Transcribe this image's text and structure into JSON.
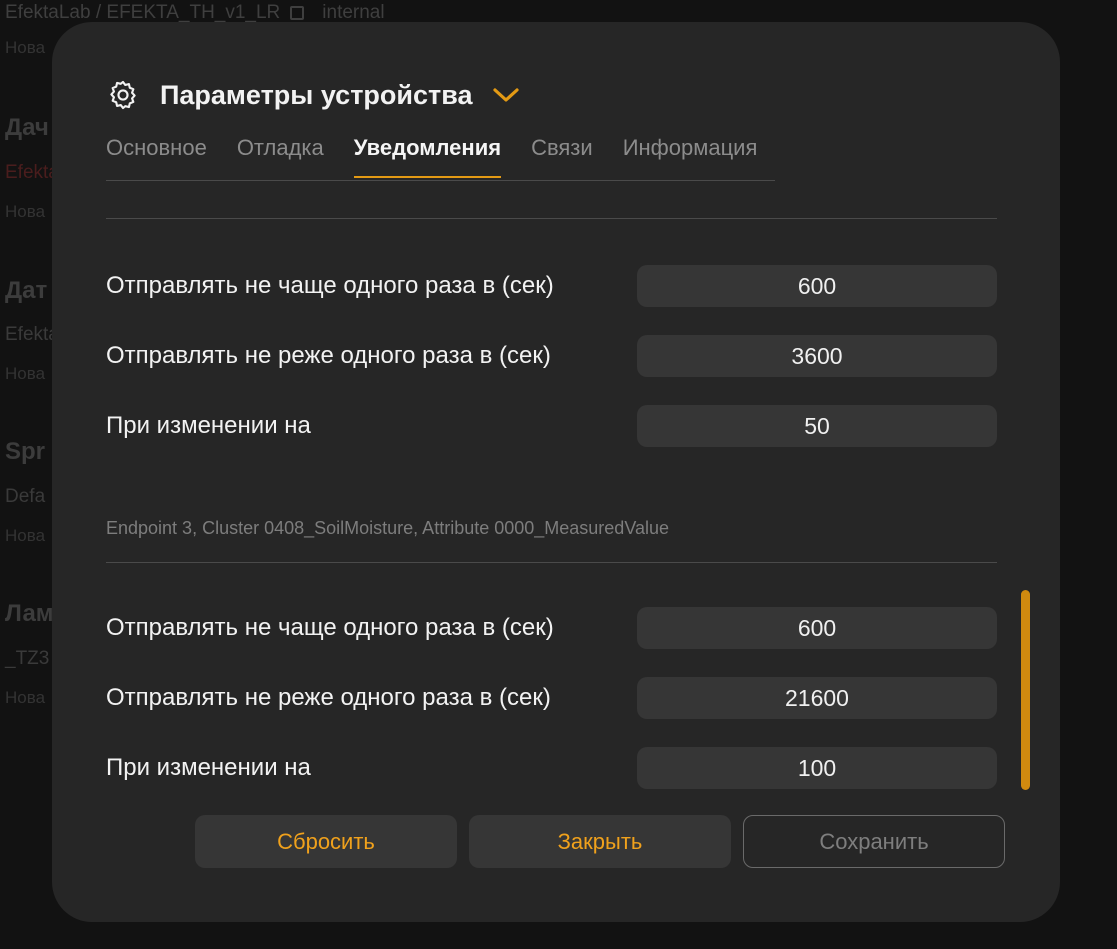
{
  "background": {
    "header_text": "EfektaLab / EFEKTA_TH_v1_LR",
    "header_tag": "internal",
    "items": [
      {
        "title": "Дач",
        "model": "Efekta",
        "sub": "Нова"
      },
      {
        "title": "Дат",
        "model": "Efekta",
        "sub": "Нова"
      },
      {
        "title": "Spr",
        "model": "Defa",
        "sub": "Нова"
      },
      {
        "title": "Лам",
        "model": "_TZ3",
        "sub": "Нова"
      }
    ],
    "first_sub": "Нова"
  },
  "modal": {
    "title": "Параметры устройства",
    "tabs": [
      {
        "label": "Основное",
        "active": false
      },
      {
        "label": "Отладка",
        "active": false
      },
      {
        "label": "Уведомления",
        "active": true
      },
      {
        "label": "Связи",
        "active": false
      },
      {
        "label": "Информация",
        "active": false
      }
    ],
    "section1": {
      "rows": [
        {
          "label": "Отправлять не чаще одного раза в (сек)",
          "value": "600"
        },
        {
          "label": "Отправлять не реже одного раза в (сек)",
          "value": "3600"
        },
        {
          "label": "При изменении на",
          "value": "50"
        }
      ]
    },
    "section2": {
      "caption": "Endpoint 3, Cluster 0408_SoilMoisture, Attribute 0000_MeasuredValue",
      "rows": [
        {
          "label": "Отправлять не чаще одного раза в (сек)",
          "value": "600"
        },
        {
          "label": "Отправлять не реже одного раза в (сек)",
          "value": "21600"
        },
        {
          "label": "При изменении на",
          "value": "100"
        }
      ]
    },
    "buttons": {
      "reset": "Сбросить",
      "close": "Закрыть",
      "save": "Сохранить"
    }
  },
  "colors": {
    "accent": "#e39a14",
    "modal_bg": "#262626",
    "field_bg": "#363636",
    "scrollbar": "#d18a0f"
  },
  "icons": {
    "settings": "gear-icon",
    "dropdown": "chevron-down-icon",
    "external": "external-link-icon"
  }
}
